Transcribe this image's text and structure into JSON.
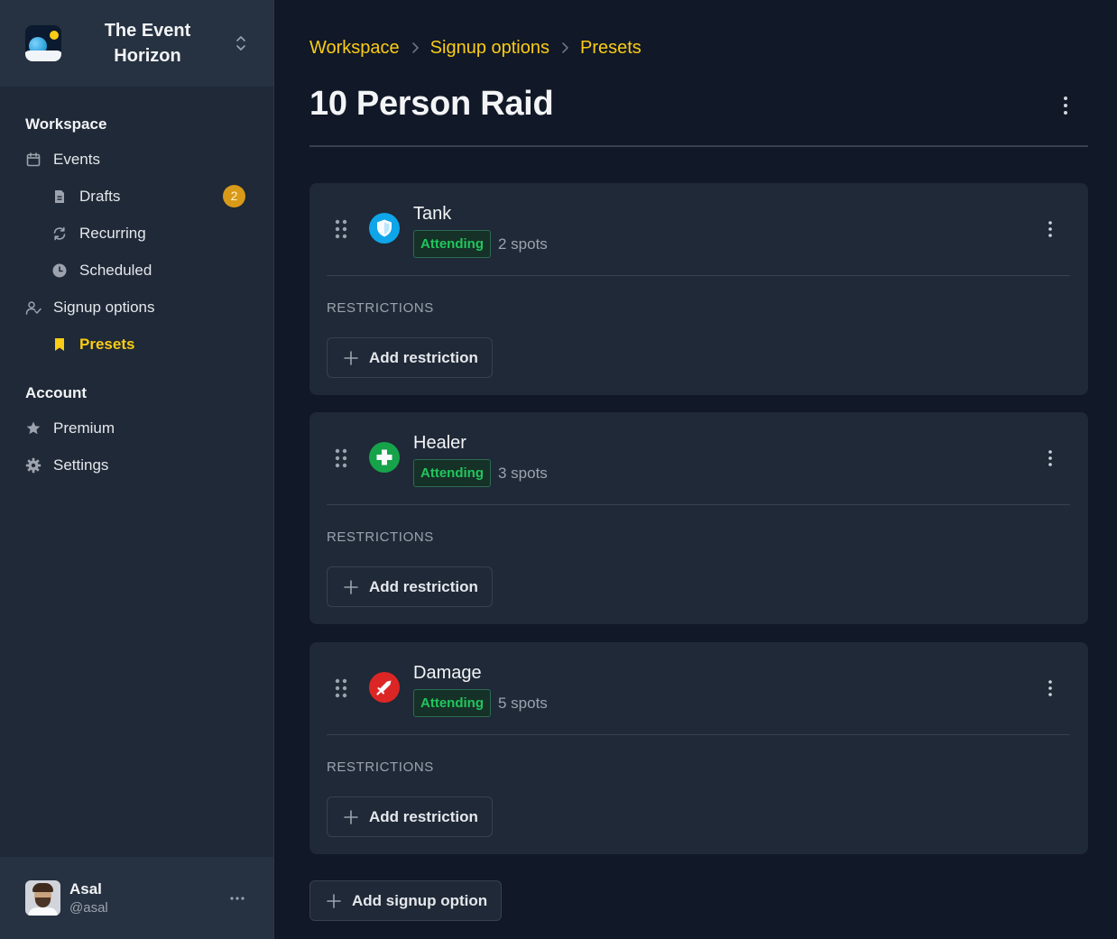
{
  "brand": {
    "name": "The Event Horizon"
  },
  "sidebar": {
    "workspace_heading": "Workspace",
    "account_heading": "Account",
    "items": [
      {
        "label": "Events",
        "icon": "calendar-icon"
      },
      {
        "label": "Drafts",
        "icon": "document-icon",
        "badge": "2"
      },
      {
        "label": "Recurring",
        "icon": "refresh-icon"
      },
      {
        "label": "Scheduled",
        "icon": "clock-icon"
      },
      {
        "label": "Signup options",
        "icon": "user-check-icon"
      },
      {
        "label": "Presets",
        "icon": "bookmark-icon",
        "active": true
      }
    ],
    "account_items": [
      {
        "label": "Premium",
        "icon": "star-icon"
      },
      {
        "label": "Settings",
        "icon": "gear-icon"
      }
    ]
  },
  "user": {
    "name": "Asal",
    "handle": "@asal"
  },
  "breadcrumb": [
    "Workspace",
    "Signup options",
    "Presets"
  ],
  "page": {
    "title": "10 Person Raid"
  },
  "roles": [
    {
      "name": "Tank",
      "status": "Attending",
      "spots": "2 spots",
      "icon": "shield-icon",
      "color": "#0ea5e9"
    },
    {
      "name": "Healer",
      "status": "Attending",
      "spots": "3 spots",
      "icon": "cross-icon",
      "color": "#16a34a"
    },
    {
      "name": "Damage",
      "status": "Attending",
      "spots": "5 spots",
      "icon": "sword-icon",
      "color": "#dc2626"
    }
  ],
  "restrictions_label": "RESTRICTIONS",
  "add_restriction_label": "Add restriction",
  "add_signup_option_label": "Add signup option",
  "colors": {
    "accent": "#facc15",
    "attending": "#22c55e",
    "background": "#111827",
    "panel": "#1f2937"
  }
}
